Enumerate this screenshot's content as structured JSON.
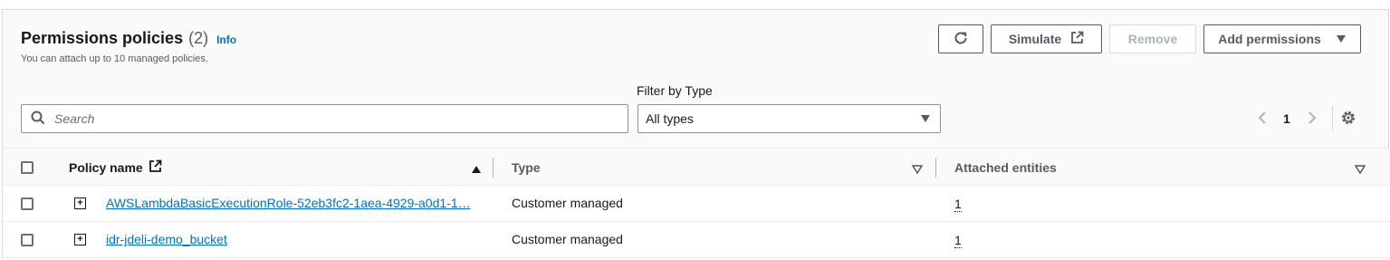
{
  "header": {
    "title": "Permissions policies",
    "count": "(2)",
    "info_link": "Info",
    "subtitle": "You can attach up to 10 managed policies."
  },
  "toolbar": {
    "refresh_icon": "refresh-icon",
    "simulate_label": "Simulate",
    "simulate_icon": "external-link-icon",
    "remove_label": "Remove",
    "add_permissions_label": "Add permissions"
  },
  "filters": {
    "search_placeholder": "Search",
    "filter_label": "Filter by Type",
    "type_selected": "All types"
  },
  "pagination": {
    "current_page": "1"
  },
  "table": {
    "columns": {
      "policy_name": "Policy name",
      "type": "Type",
      "attached_entities": "Attached entities"
    },
    "rows": [
      {
        "policy_name": "AWSLambdaBasicExecutionRole-52eb3fc2-1aea-4929-a0d1-1…",
        "type": "Customer managed",
        "attached": "1"
      },
      {
        "policy_name": "idr-jdeli-demo_bucket",
        "type": "Customer managed",
        "attached": "1"
      }
    ]
  },
  "colors": {
    "link": "#0073bb",
    "text": "#16191f",
    "secondary_text": "#545b64",
    "border": "#d5dbdb"
  }
}
